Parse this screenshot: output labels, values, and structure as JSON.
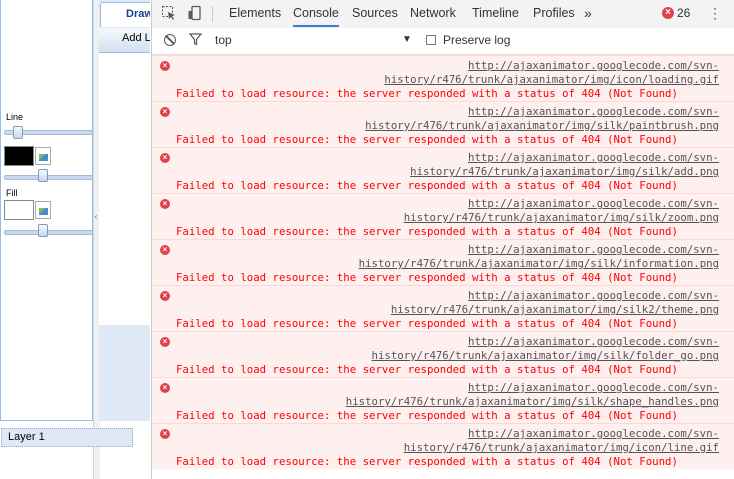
{
  "app": {
    "tab_label": "Draw",
    "add_button_label": "Add L",
    "line_label": "Line",
    "fill_label": "Fill",
    "layer_name": "Layer 1",
    "colors": {
      "line_swatch": "#000000",
      "fill_swatch": "#ffffff",
      "panel_border": "#99bbe8"
    }
  },
  "devtools": {
    "tabs": [
      {
        "label": "Elements",
        "active": false
      },
      {
        "label": "Console",
        "active": true
      },
      {
        "label": "Sources",
        "active": false
      },
      {
        "label": "Network",
        "active": false
      },
      {
        "label": "Timeline",
        "active": false
      },
      {
        "label": "Profiles",
        "active": false
      }
    ],
    "more_tabs_glyph": "»",
    "error_count": "26",
    "filter": {
      "context": "top",
      "preserve_log_label": "Preserve log",
      "preserve_log_checked": false
    },
    "messages": [
      {
        "url_line1": "http://ajaxanimator.googlecode.com/svn-",
        "url_line2": "history/r476/trunk/ajaxanimator/img/icon/loading.gif",
        "text": "Failed to load resource: the server responded with a status of 404 (Not Found)"
      },
      {
        "url_line1": "http://ajaxanimator.googlecode.com/svn-",
        "url_line2": "history/r476/trunk/ajaxanimator/img/silk/paintbrush.png",
        "text": "Failed to load resource: the server responded with a status of 404 (Not Found)"
      },
      {
        "url_line1": "http://ajaxanimator.googlecode.com/svn-",
        "url_line2": "history/r476/trunk/ajaxanimator/img/silk/add.png",
        "text": "Failed to load resource: the server responded with a status of 404 (Not Found)"
      },
      {
        "url_line1": "http://ajaxanimator.googlecode.com/svn-",
        "url_line2": "history/r476/trunk/ajaxanimator/img/silk/zoom.png",
        "text": "Failed to load resource: the server responded with a status of 404 (Not Found)"
      },
      {
        "url_line1": "http://ajaxanimator.googlecode.com/svn-",
        "url_line2": "history/r476/trunk/ajaxanimator/img/silk/information.png",
        "text": "Failed to load resource: the server responded with a status of 404 (Not Found)"
      },
      {
        "url_line1": "http://ajaxanimator.googlecode.com/svn-",
        "url_line2": "history/r476/trunk/ajaxanimator/img/silk2/theme.png",
        "text": "Failed to load resource: the server responded with a status of 404 (Not Found)"
      },
      {
        "url_line1": "http://ajaxanimator.googlecode.com/svn-",
        "url_line2": "history/r476/trunk/ajaxanimator/img/silk/folder_go.png",
        "text": "Failed to load resource: the server responded with a status of 404 (Not Found)"
      },
      {
        "url_line1": "http://ajaxanimator.googlecode.com/svn-",
        "url_line2": "history/r476/trunk/ajaxanimator/img/silk/shape_handles.png",
        "text": "Failed to load resource: the server responded with a status of 404 (Not Found)"
      },
      {
        "url_line1": "http://ajaxanimator.googlecode.com/svn-",
        "url_line2": "history/r476/trunk/ajaxanimator/img/icon/line.gif",
        "text": "Failed to load resource: the server responded with a status of 404 (Not Found)"
      }
    ],
    "colors": {
      "error_text": "#ff0000",
      "error_bg": "#fff0f0",
      "active_tab_underline": "#3879d9",
      "error_badge": "#e0424a"
    }
  }
}
